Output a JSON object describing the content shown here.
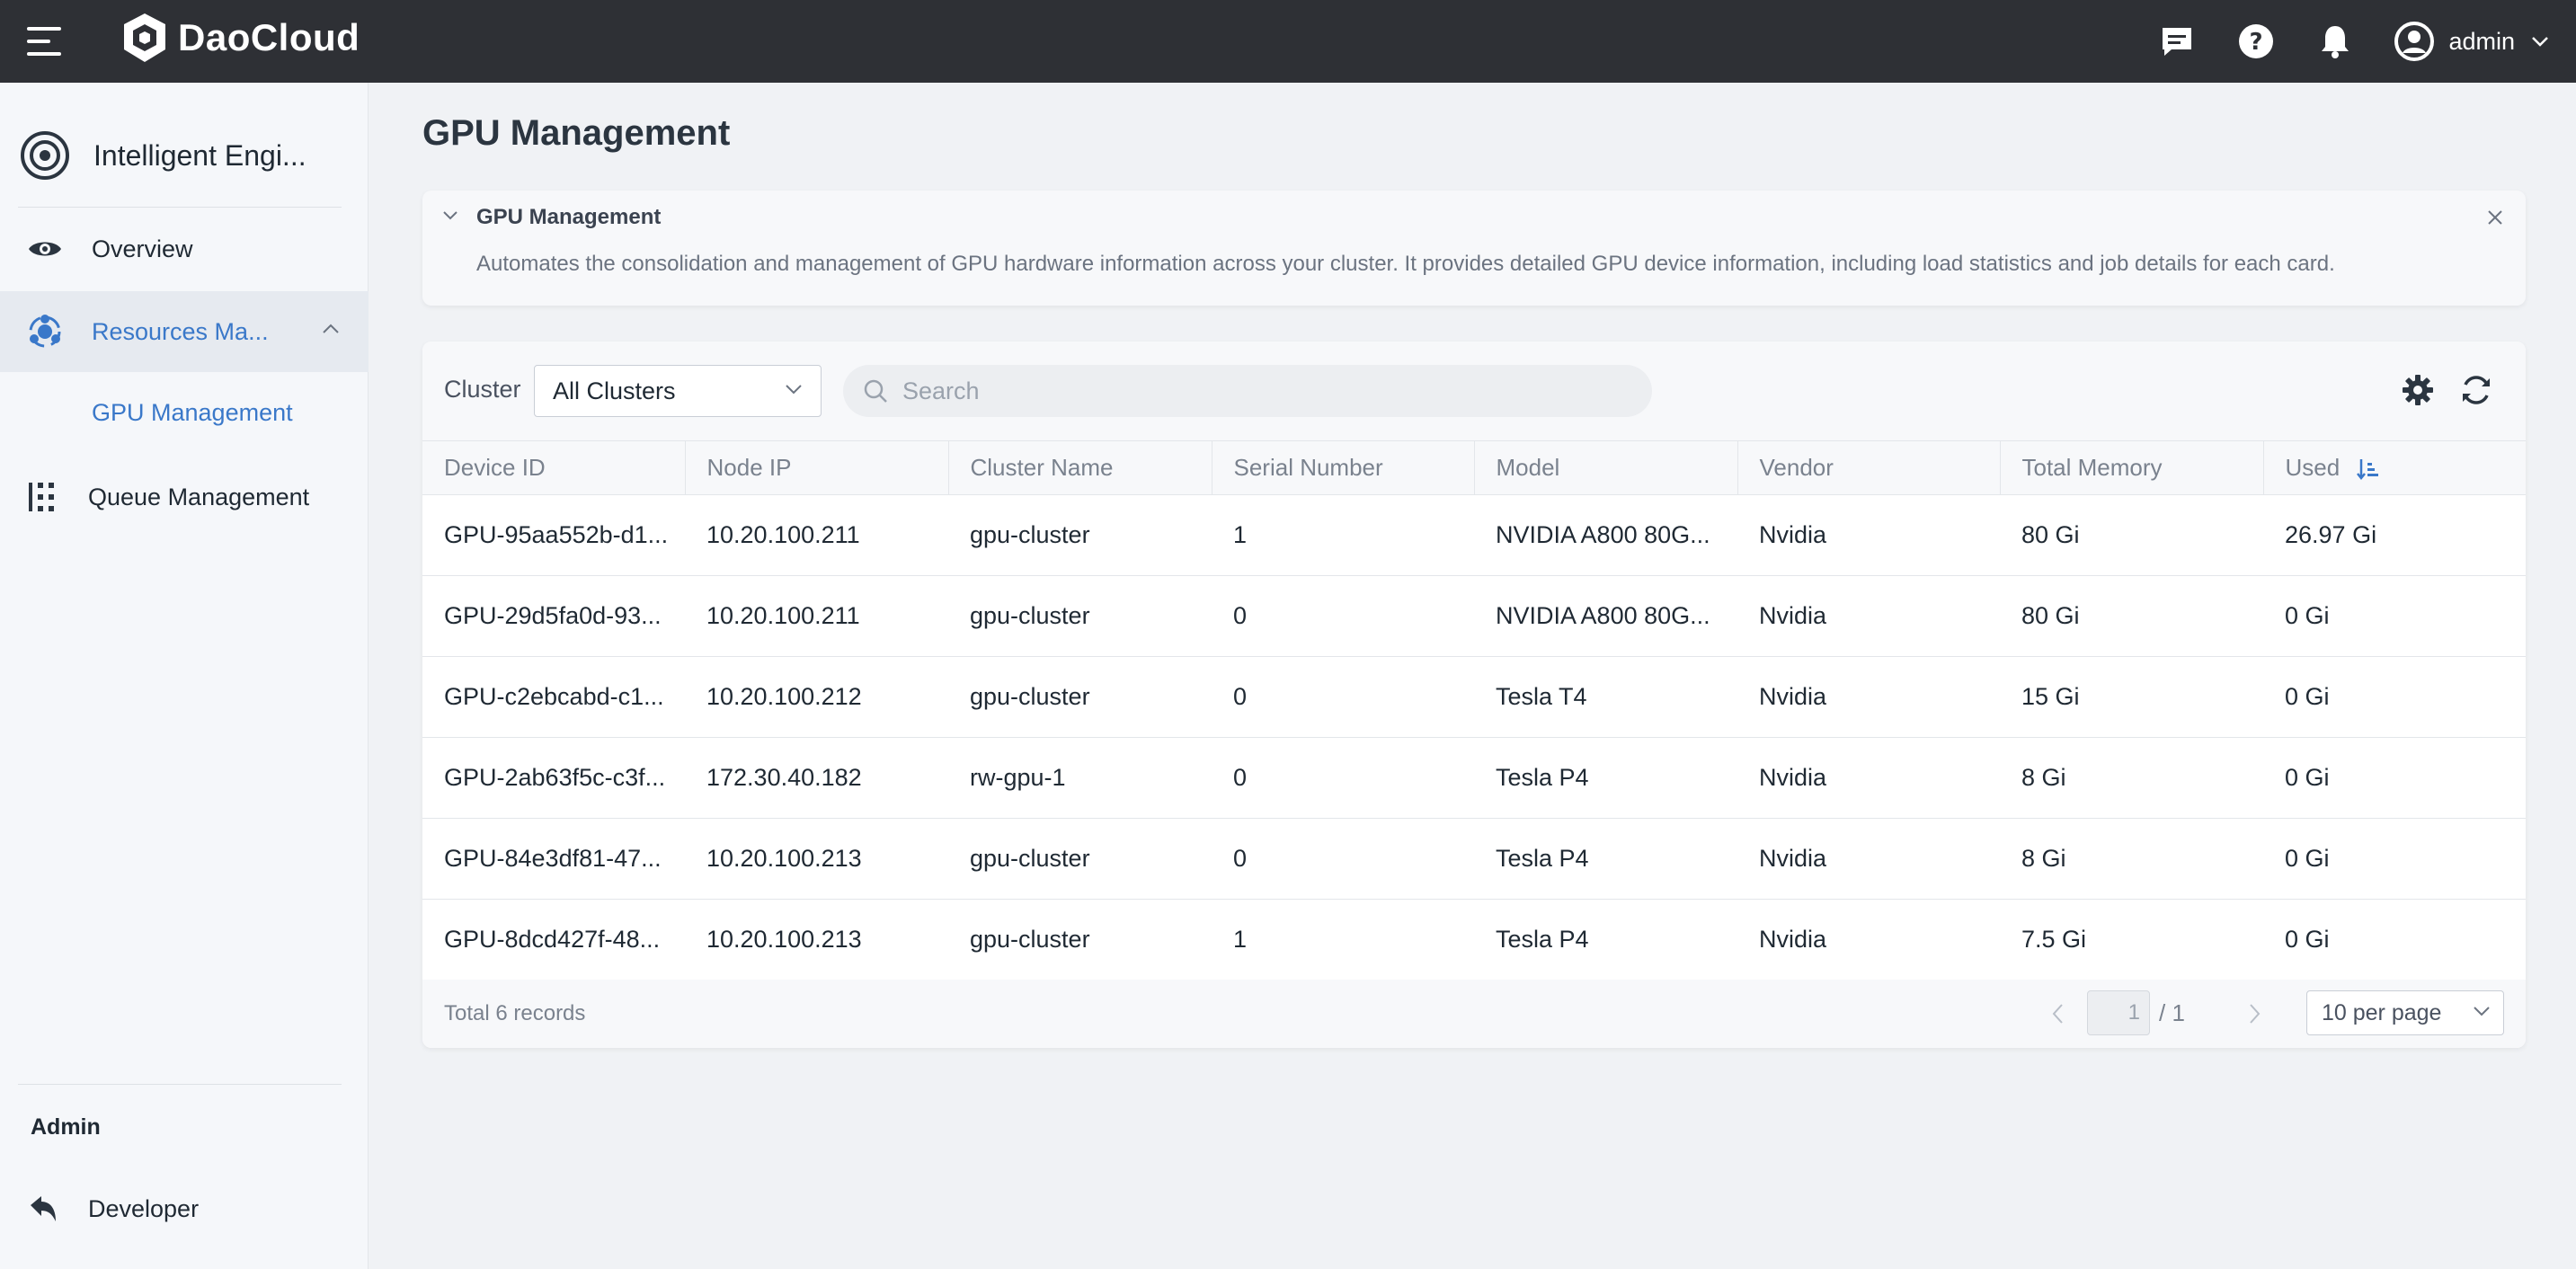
{
  "header": {
    "brand": "DaoCloud",
    "user": "admin",
    "icons": [
      "menu-icon",
      "message-icon",
      "help-icon",
      "bell-icon",
      "user-avatar-icon",
      "chevron-down-icon"
    ]
  },
  "sidebar": {
    "module": "Intelligent Engi...",
    "items": [
      {
        "label": "Overview"
      },
      {
        "label": "Resources Ma..."
      },
      {
        "label": "GPU Management"
      },
      {
        "label": "Queue Management"
      }
    ],
    "section_label": "Admin",
    "developer": "Developer"
  },
  "page": {
    "title": "GPU Management"
  },
  "info": {
    "title": "GPU Management",
    "description": "Automates the consolidation and management of GPU hardware information across your cluster. It provides detailed GPU device information, including load statistics and job details for each card."
  },
  "toolbar": {
    "cluster_label": "Cluster",
    "cluster_value": "All Clusters",
    "search_placeholder": "Search"
  },
  "table": {
    "columns": [
      "Device ID",
      "Node IP",
      "Cluster Name",
      "Serial Number",
      "Model",
      "Vendor",
      "Total Memory",
      "Used"
    ],
    "rows": [
      [
        "GPU-95aa552b-d1...",
        "10.20.100.211",
        "gpu-cluster",
        "1",
        "NVIDIA A800 80G...",
        "Nvidia",
        "80 Gi",
        "26.97 Gi"
      ],
      [
        "GPU-29d5fa0d-93...",
        "10.20.100.211",
        "gpu-cluster",
        "0",
        "NVIDIA A800 80G...",
        "Nvidia",
        "80 Gi",
        "0 Gi"
      ],
      [
        "GPU-c2ebcabd-c1...",
        "10.20.100.212",
        "gpu-cluster",
        "0",
        "Tesla T4",
        "Nvidia",
        "15 Gi",
        "0 Gi"
      ],
      [
        "GPU-2ab63f5c-c3f...",
        "172.30.40.182",
        "rw-gpu-1",
        "0",
        "Tesla P4",
        "Nvidia",
        "8 Gi",
        "0 Gi"
      ],
      [
        "GPU-84e3df81-47...",
        "10.20.100.213",
        "gpu-cluster",
        "0",
        "Tesla P4",
        "Nvidia",
        "8 Gi",
        "0 Gi"
      ],
      [
        "GPU-8dcd427f-48...",
        "10.20.100.213",
        "gpu-cluster",
        "1",
        "Tesla P4",
        "Nvidia",
        "7.5 Gi",
        "0 Gi"
      ]
    ]
  },
  "pagination": {
    "total": "Total 6 records",
    "current": "1",
    "of_pages": "/ 1",
    "per_page": "10 per page"
  },
  "colors": {
    "topbar": "#2e3035",
    "accent": "#3a78c9",
    "sidebar": "#f5f7fa",
    "background": "#f0f2f5"
  }
}
